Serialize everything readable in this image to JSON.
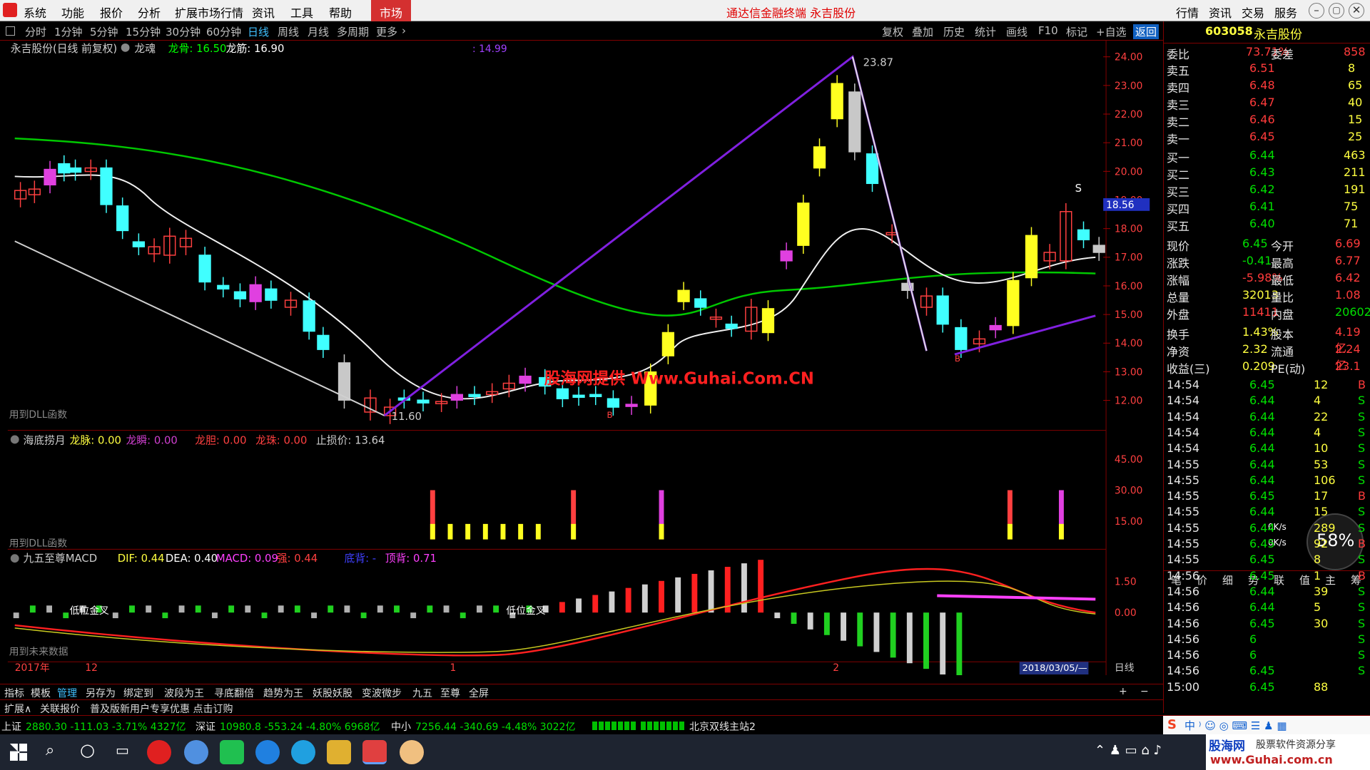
{
  "menu": {
    "items": [
      "系统",
      "功能",
      "报价",
      "分析",
      "扩展市场行情",
      "资讯",
      "工具",
      "帮助"
    ],
    "market": "市场",
    "title": "通达信金融终端 永吉股份",
    "right": [
      "行情",
      "资讯",
      "交易",
      "服务"
    ]
  },
  "periods": [
    "分时",
    "1分钟",
    "5分钟",
    "15分钟",
    "30分钟",
    "60分钟",
    "日线",
    "周线",
    "月线",
    "多周期",
    "更多"
  ],
  "tools": [
    "复权",
    "叠加",
    "历史",
    "统计",
    "画线",
    "F10",
    "标记",
    "+自选",
    "返回"
  ],
  "main": {
    "caption": "永吉股份(日线 前复权)",
    "indicator": "龙魂",
    "l1": "龙骨: 16.50",
    "l2": "龙筋: 16.90",
    "cursor_val": ": 14.99",
    "dll": "用到DLL函数",
    "high": "23.87",
    "low": "11.60",
    "pricetag": "18.56",
    "watermark": "股海网提供 Www.Guhai.Com.CN",
    "s_mark": "S",
    "b_mark": "B",
    "yticks": [
      "24.00",
      "23.00",
      "22.00",
      "21.00",
      "20.00",
      "19.00",
      "18.00",
      "17.00",
      "16.00",
      "15.00",
      "14.00",
      "13.00",
      "12.00"
    ]
  },
  "sub1": {
    "name": "海底捞月",
    "a": "龙脉: 0.00",
    "b": "龙瞬: 0.00",
    "c": "龙胆: 0.00",
    "d": "龙珠: 0.00",
    "e": "止损价: 13.64",
    "dll": "用到DLL函数",
    "yticks": [
      "45.00",
      "30.00",
      "15.00"
    ]
  },
  "sub2": {
    "name": "九五至尊MACD",
    "dif": "DIF: 0.44",
    "dea": "DEA: 0.40",
    "macd": "MACD: 0.09",
    "f": "强: 0.44",
    "g": "底背: -",
    "h": "顶背: 0.71",
    "note": "用到未来数据",
    "lab1": "低位金叉",
    "lab2": "低位金叉",
    "yticks": [
      "1.50",
      "0.00"
    ]
  },
  "dates": {
    "y": "2017年",
    "m12": "12",
    "m1": "1",
    "m2": "2",
    "cur": "2018/03/05/—",
    "period": "日线"
  },
  "btabs": [
    "指标",
    "模板",
    "管理",
    "另存为",
    "绑定到",
    "波段为王",
    "寻底翻倍",
    "趋势为王",
    "妖股妖股",
    "变波微步",
    "九五",
    "至尊",
    "全屏"
  ],
  "stock": {
    "code": "603058",
    "name": "永吉股份",
    "wb": "73.71%",
    "wc": "858",
    "asks": [
      [
        "卖五",
        "6.51",
        "8"
      ],
      [
        "卖四",
        "6.48",
        "65"
      ],
      [
        "卖三",
        "6.47",
        "40"
      ],
      [
        "卖二",
        "6.46",
        "15"
      ],
      [
        "卖一",
        "6.45",
        "25"
      ]
    ],
    "bids": [
      [
        "买一",
        "6.44",
        "463"
      ],
      [
        "买二",
        "6.43",
        "211"
      ],
      [
        "买三",
        "6.42",
        "191"
      ],
      [
        "买四",
        "6.41",
        "75"
      ],
      [
        "买五",
        "6.40",
        "71"
      ]
    ],
    "info": [
      [
        "现价",
        "6.45",
        "今开",
        "6.69"
      ],
      [
        "涨跌",
        "-0.41",
        "最高",
        "6.77"
      ],
      [
        "涨幅",
        "-5.98%",
        "最低",
        "6.42"
      ],
      [
        "总量",
        "32013",
        "量比",
        "1.08"
      ],
      [
        "外盘",
        "11411",
        "内盘",
        "20602"
      ],
      [
        "换手",
        "1.43%",
        "股本",
        "4.19亿"
      ],
      [
        "净资",
        "2.32",
        "流通",
        "2.24亿"
      ],
      [
        "收益(三)",
        "0.209",
        "PE(动)",
        "23.1"
      ]
    ],
    "ticks": [
      [
        "14:54",
        "6.45",
        "12",
        "B"
      ],
      [
        "14:54",
        "6.44",
        "4",
        "S"
      ],
      [
        "14:54",
        "6.44",
        "22",
        "S"
      ],
      [
        "14:54",
        "6.44",
        "4",
        "S"
      ],
      [
        "14:54",
        "6.44",
        "10",
        "S"
      ],
      [
        "14:55",
        "6.44",
        "53",
        "S"
      ],
      [
        "14:55",
        "6.44",
        "106",
        "S"
      ],
      [
        "14:55",
        "6.45",
        "17",
        "B"
      ],
      [
        "14:55",
        "6.44",
        "15",
        "S"
      ],
      [
        "14:55",
        "6.44",
        "289",
        "S"
      ],
      [
        "14:55",
        "6.45",
        "92",
        "B"
      ],
      [
        "14:55",
        "6.45",
        "8",
        "S"
      ],
      [
        "14:56",
        "6.45",
        "1",
        "B"
      ],
      [
        "14:56",
        "6.44",
        "39",
        "S"
      ],
      [
        "14:56",
        "6.44",
        "5",
        "S"
      ],
      [
        "14:56",
        "6.45",
        "30",
        "S"
      ],
      [
        "14:56",
        "6",
        "",
        "S"
      ],
      [
        "14:56",
        "6",
        "",
        "S"
      ],
      [
        "14:56",
        "6.45",
        "",
        "S"
      ],
      [
        "15:00",
        "6.45",
        "88",
        ""
      ]
    ],
    "speed": "58%",
    "up": "0K/s",
    "down": "0K/s",
    "tabs": [
      "笔",
      "价",
      "细",
      "势",
      "联",
      "值",
      "主",
      "筹"
    ]
  },
  "status": {
    "sh": "上证",
    "sh_v": "2880.30 -111.03 -3.71% 4327亿",
    "sz": "深证",
    "sz_v": "10980.8 -553.24 -4.80% 6968亿",
    "zx": "中小",
    "zx_v": "7256.44 -340.69 -4.48% 3022亿",
    "server": "北京双线主站2",
    "ext": "扩展∧",
    "lk": "关联报价",
    "ad": "普及版新用户专享优惠 点击订购"
  },
  "brand": {
    "a": "股海网",
    "b": "股票软件资源分享",
    "c": "www.Guhai.com.cn"
  }
}
